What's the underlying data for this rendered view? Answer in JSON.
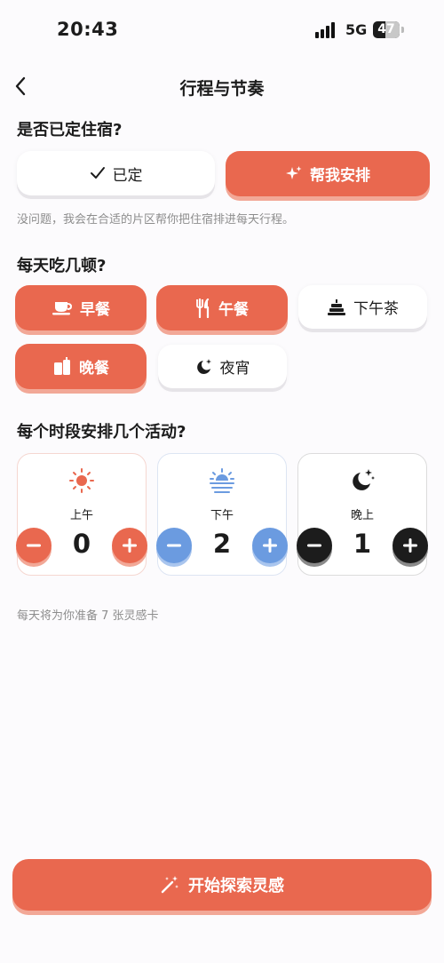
{
  "status": {
    "time": "20:43",
    "network": "5G",
    "battery": "47",
    "battery_level": 0.47
  },
  "nav": {
    "title": "行程与节奏"
  },
  "lodging": {
    "title": "是否已定住宿?",
    "options": [
      {
        "label": "已定",
        "icon": "check-icon",
        "selected": false
      },
      {
        "label": "帮我安排",
        "icon": "sparkle-icon",
        "selected": true
      }
    ],
    "hint": "没问题，我会在合适的片区帮你把住宿排进每天行程。"
  },
  "meals": {
    "title": "每天吃几顿?",
    "options": [
      {
        "label": "早餐",
        "icon": "coffee-cup-icon",
        "selected": true
      },
      {
        "label": "午餐",
        "icon": "fork-knife-icon",
        "selected": true
      },
      {
        "label": "下午茶",
        "icon": "cake-icon",
        "selected": false
      },
      {
        "label": "晚餐",
        "icon": "drinks-icon",
        "selected": true
      },
      {
        "label": "夜宵",
        "icon": "moon-icon",
        "selected": false
      }
    ]
  },
  "activities": {
    "title": "每个时段安排几个活动?",
    "periods": [
      {
        "label": "上午",
        "count": "0",
        "icon": "sun-icon",
        "accent": "#e9684f",
        "border": "#f5d7d1"
      },
      {
        "label": "下午",
        "count": "2",
        "icon": "sunset-icon",
        "accent": "#6b9be0",
        "border": "#dde5f3"
      },
      {
        "label": "晚上",
        "count": "1",
        "icon": "moon-stars-icon",
        "accent": "#1c1c1c",
        "border": "#dcdcdc"
      }
    ],
    "summary": "每天将为你准备 7 张灵感卡"
  },
  "cta": {
    "label": "开始探索灵感",
    "icon": "magic-wand-icon"
  },
  "colors": {
    "accent": "#e9684f",
    "accent_shadow": "#f2a897",
    "afternoon_blue": "#6b9be0",
    "evening_black": "#1c1c1c"
  }
}
